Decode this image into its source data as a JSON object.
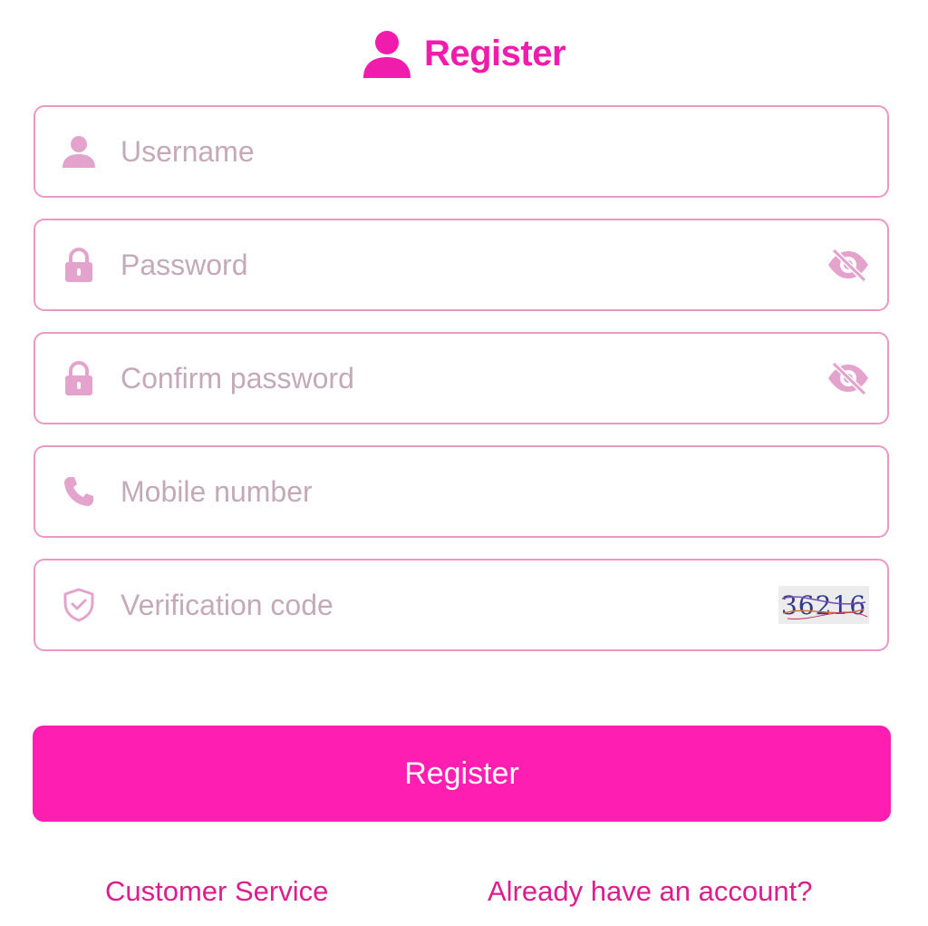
{
  "header": {
    "icon": "user-icon",
    "title": "Register"
  },
  "fields": [
    {
      "icon": "user-icon",
      "placeholder": "Username",
      "value": ""
    },
    {
      "icon": "lock-icon",
      "placeholder": "Password",
      "value": "",
      "trailing": "eye-off-icon"
    },
    {
      "icon": "lock-icon",
      "placeholder": "Confirm password",
      "value": "",
      "trailing": "eye-off-icon"
    },
    {
      "icon": "phone-icon",
      "placeholder": "Mobile number",
      "value": ""
    },
    {
      "icon": "shield-check-icon",
      "placeholder": "Verification code",
      "value": "",
      "trailing": "captcha-image"
    }
  ],
  "captcha": {
    "text": "36216"
  },
  "submit": {
    "label": "Register"
  },
  "footer": {
    "customer_service": "Customer Service",
    "login_link": "Already have an account?"
  },
  "colors": {
    "accent": "#fe1eb2",
    "title": "#f01cac",
    "border": "#ec98c6",
    "icon": "#e3a3cc",
    "placeholder": "#c4aab7",
    "link": "#dd1c8d"
  }
}
